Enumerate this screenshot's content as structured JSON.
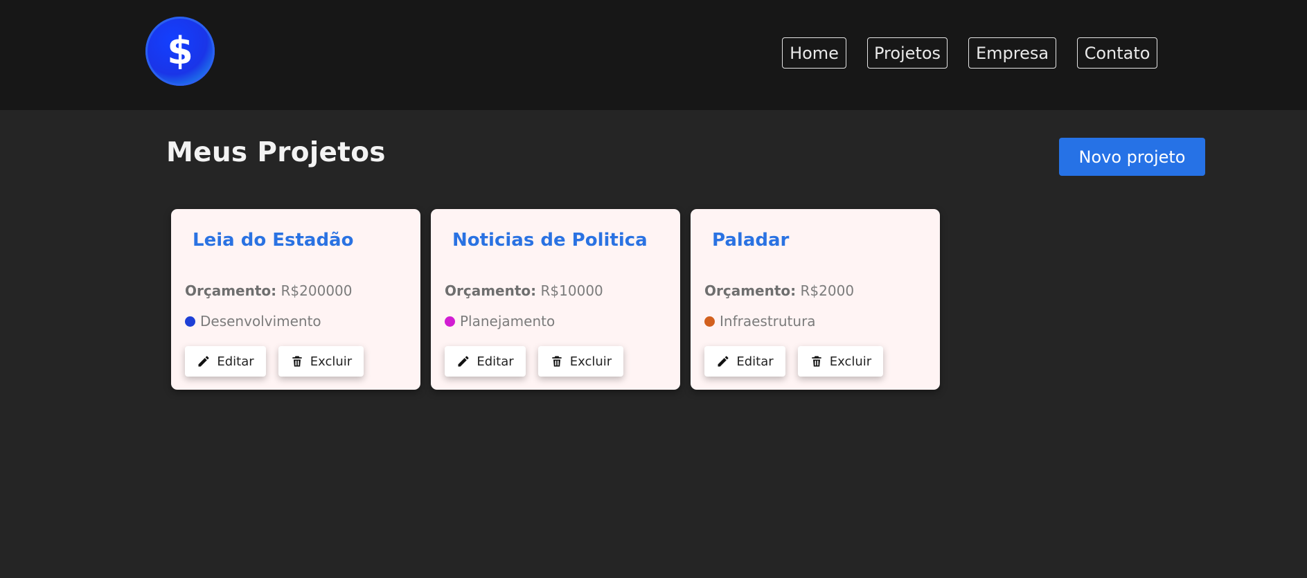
{
  "header": {
    "logo_symbol": "$",
    "nav": [
      {
        "label": "Home"
      },
      {
        "label": "Projetos"
      },
      {
        "label": "Empresa"
      },
      {
        "label": "Contato"
      }
    ]
  },
  "main": {
    "title": "Meus Projetos",
    "new_project_label": "Novo projeto",
    "budget_label": "Orçamento:",
    "edit_label": "Editar",
    "delete_label": "Excluir",
    "projects": [
      {
        "name": "Leia do Estadão",
        "budget": "R$200000",
        "category": "Desenvolvimento",
        "category_color": "#1e3fd6"
      },
      {
        "name": "Noticias de Politica",
        "budget": "R$10000",
        "category": "Planejamento",
        "category_color": "#d21dd2"
      },
      {
        "name": "Paladar",
        "budget": "R$2000",
        "category": "Infraestrutura",
        "category_color": "#d2601e"
      }
    ]
  },
  "colors": {
    "accent": "#2672e6",
    "title_blue": "#2a72e2",
    "header_bg": "#171717",
    "page_bg": "#252525",
    "card_bg": "#fff4f4"
  },
  "icons": {
    "logo": "dollar-icon",
    "edit": "pencil-icon",
    "delete": "trash-icon"
  }
}
